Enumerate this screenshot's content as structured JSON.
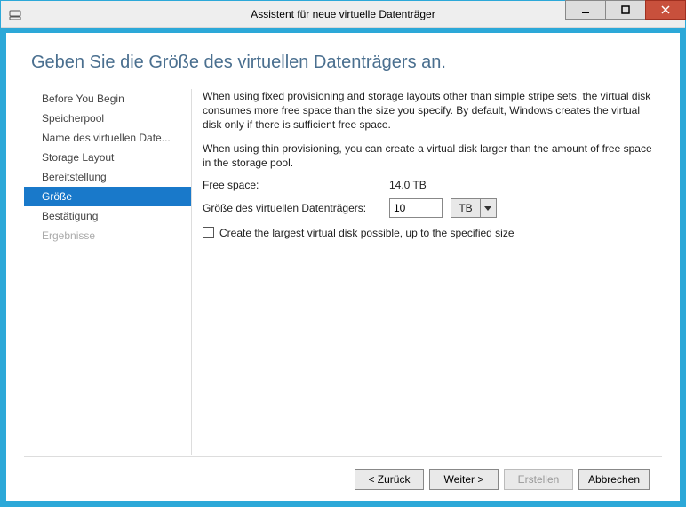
{
  "window": {
    "title": "Assistent für neue virtuelle Datenträger"
  },
  "page": {
    "title": "Geben Sie die Größe des virtuellen Datenträgers an."
  },
  "sidebar": {
    "items": [
      {
        "label": "Before You Begin",
        "state": "normal"
      },
      {
        "label": "Speicherpool",
        "state": "normal"
      },
      {
        "label": "Name des virtuellen Date...",
        "state": "normal"
      },
      {
        "label": "Storage Layout",
        "state": "normal"
      },
      {
        "label": "Bereitstellung",
        "state": "normal"
      },
      {
        "label": "Größe",
        "state": "active"
      },
      {
        "label": "Bestätigung",
        "state": "normal"
      },
      {
        "label": "Ergebnisse",
        "state": "disabled"
      }
    ]
  },
  "panel": {
    "info1": "When using fixed provisioning and storage layouts other than simple stripe sets, the virtual disk consumes more free space than the size you specify. By default, Windows creates the virtual disk only if there is sufficient free space.",
    "info2": "When using thin provisioning, you can create a virtual disk larger than the amount of free space in the storage pool.",
    "free_space_label": "Free space:",
    "free_space_value": "14.0 TB",
    "size_label": "Größe des virtuellen Datenträgers:",
    "size_value": "10",
    "size_unit": "TB",
    "checkbox_label": "Create the largest virtual disk possible, up to the specified size"
  },
  "buttons": {
    "back": "< Zurück",
    "next": "Weiter >",
    "create": "Erstellen",
    "cancel": "Abbrechen"
  }
}
